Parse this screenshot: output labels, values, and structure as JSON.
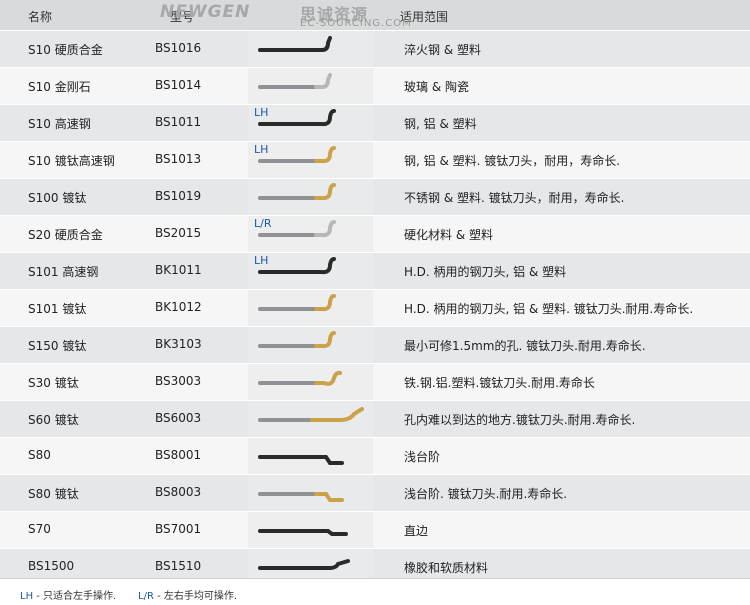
{
  "header": {
    "col_name": "名称",
    "col_model": "型号",
    "col_use": "适用范围",
    "logo_text": "NEWGEN",
    "logo_cn": "思诚资源",
    "logo_sub": "EC-SOURCING.COM"
  },
  "rows": [
    {
      "name": "S10 硬质合金",
      "model": "BS1016",
      "use": "淬火钢 & 塑料",
      "hand": "",
      "tool": "dark-short"
    },
    {
      "name": "S10 金刚石",
      "model": "BS1014",
      "use": "玻璃 & 陶瓷",
      "hand": "",
      "tool": "silver-short"
    },
    {
      "name": "S10 高速钢",
      "model": "BS1011",
      "use": "钢, 铝 & 塑料",
      "hand": "LH",
      "tool": "dark"
    },
    {
      "name": "S10 镀钛高速钢",
      "model": "BS1013",
      "use": "钢, 铝 & 塑料. 镀钛刀头，耐用，寿命长.",
      "hand": "LH",
      "tool": "gold"
    },
    {
      "name": "S100 镀钛",
      "model": "BS1019",
      "use": "不锈钢 & 塑料. 镀钛刀头，耐用，寿命长.",
      "hand": "",
      "tool": "gold"
    },
    {
      "name": "S20 硬质合金",
      "model": "BS2015",
      "use": "硬化材料 & 塑料",
      "hand": "L/R",
      "tool": "silver"
    },
    {
      "name": "S101 高速钢",
      "model": "BK1011",
      "use": "H.D. 柄用的钢刀头, 铝 & 塑料",
      "hand": "LH",
      "tool": "dark"
    },
    {
      "name": "S101 镀钛",
      "model": "BK1012",
      "use": "H.D. 柄用的钢刀头, 铝 & 塑料. 镀钛刀头.耐用.寿命长.",
      "hand": "",
      "tool": "gold"
    },
    {
      "name": "S150 镀钛",
      "model": "BK3103",
      "use": "最小可修1.5mm的孔. 镀钛刀头.耐用.寿命长.",
      "hand": "",
      "tool": "gold-small"
    },
    {
      "name": "S30 镀钛",
      "model": "BS3003",
      "use": "铁.钢.铝.塑料.镀钛刀头.耐用.寿命长",
      "hand": "",
      "tool": "gold-hook"
    },
    {
      "name": "S60 镀钛",
      "model": "BS6003",
      "use": "孔内难以到达的地方.镀钛刀头.耐用.寿命长.",
      "hand": "",
      "tool": "gold-long"
    },
    {
      "name": "S80",
      "model": "BS8001",
      "use": "浅台阶",
      "hand": "",
      "tool": "black-step"
    },
    {
      "name": "S80 镀钛",
      "model": "BS8003",
      "use": "浅台阶. 镀钛刀头.耐用.寿命长.",
      "hand": "",
      "tool": "gold-step"
    },
    {
      "name": "S70",
      "model": "BS7001",
      "use": "直边",
      "hand": "",
      "tool": "black-flat"
    },
    {
      "name": "BS1500",
      "model": "BS1510",
      "use": "橡胶和软质材料",
      "hand": "",
      "tool": "black-rubber"
    }
  ],
  "footer": {
    "lh_key": "LH",
    "lh_text": " - 只适合左手操作.",
    "lr_key": "L/R",
    "lr_text": " - 左右手均可操作."
  },
  "colors": {
    "header_bg": "#d9dadc",
    "hand_label": "#1d5aa8",
    "gold": "#c9a24a",
    "silver": "#9a9a9a",
    "dark": "#2a2a2a"
  }
}
